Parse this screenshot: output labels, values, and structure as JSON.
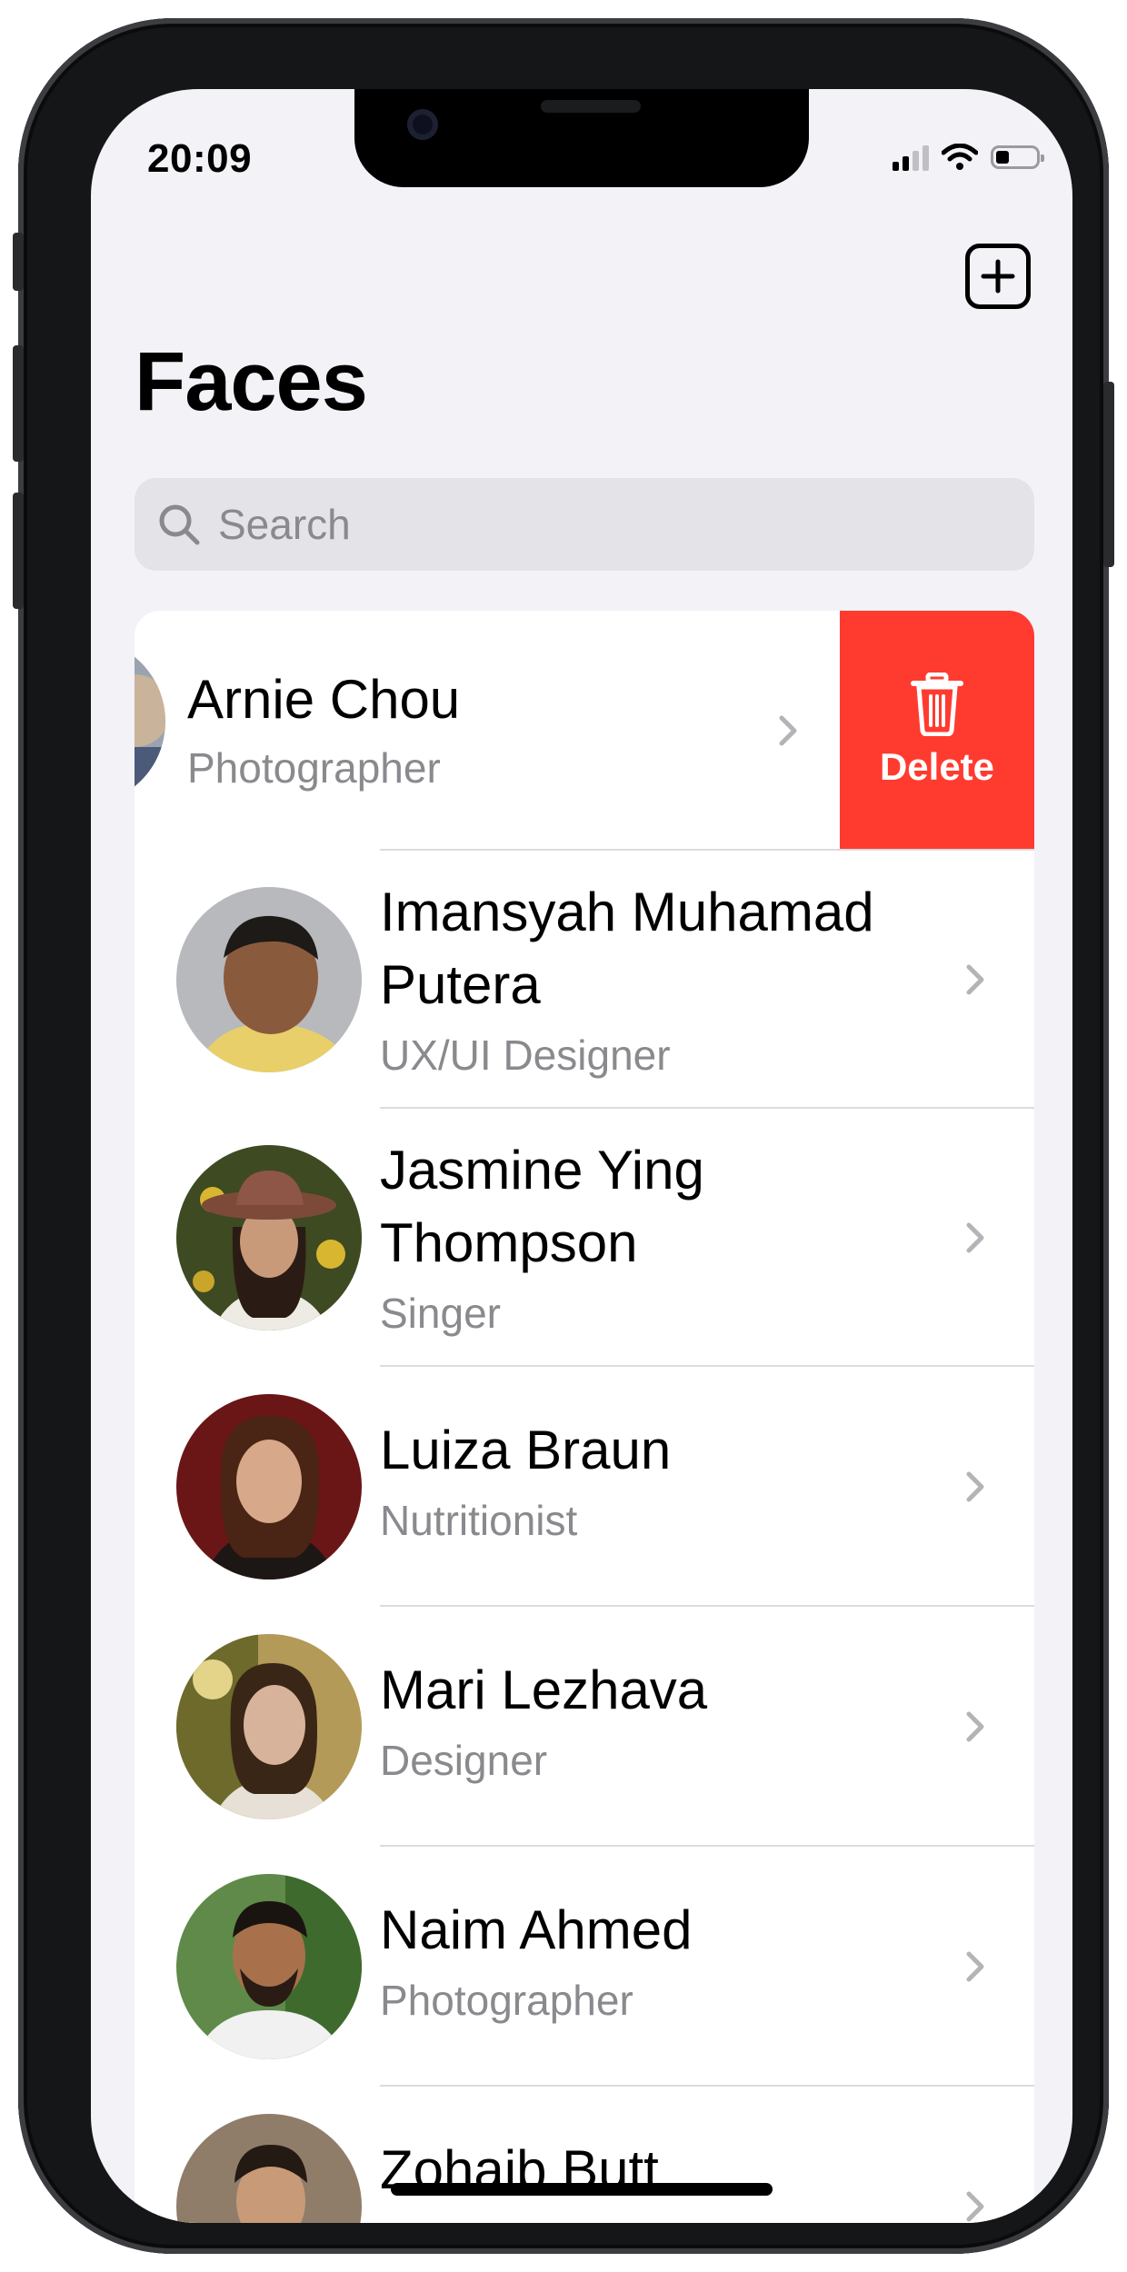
{
  "status_bar": {
    "time": "20:09"
  },
  "header": {
    "title": "Faces"
  },
  "search": {
    "placeholder": "Search"
  },
  "swiped_row": {
    "name": "Arnie Chou",
    "role": "Photographer",
    "action_label": "Delete"
  },
  "people": [
    {
      "name": "Imansyah Muhamad Putera",
      "role": "UX/UI Designer"
    },
    {
      "name": "Jasmine Ying Thompson",
      "role": "Singer"
    },
    {
      "name": "Luiza Braun",
      "role": "Nutritionist"
    },
    {
      "name": "Mari Lezhava",
      "role": "Designer"
    },
    {
      "name": "Naim Ahmed",
      "role": "Photographer"
    },
    {
      "name": "Zohaib Butt",
      "role": ""
    }
  ],
  "colors": {
    "background": "#f2f2f7",
    "delete": "#ff3b30",
    "secondary_text": "#8a8a8e",
    "separator": "#dcdcdf"
  },
  "icons": [
    "add-icon",
    "search-icon",
    "trash-icon",
    "chevron-right-icon",
    "wifi-icon",
    "signal-icon",
    "battery-icon"
  ]
}
